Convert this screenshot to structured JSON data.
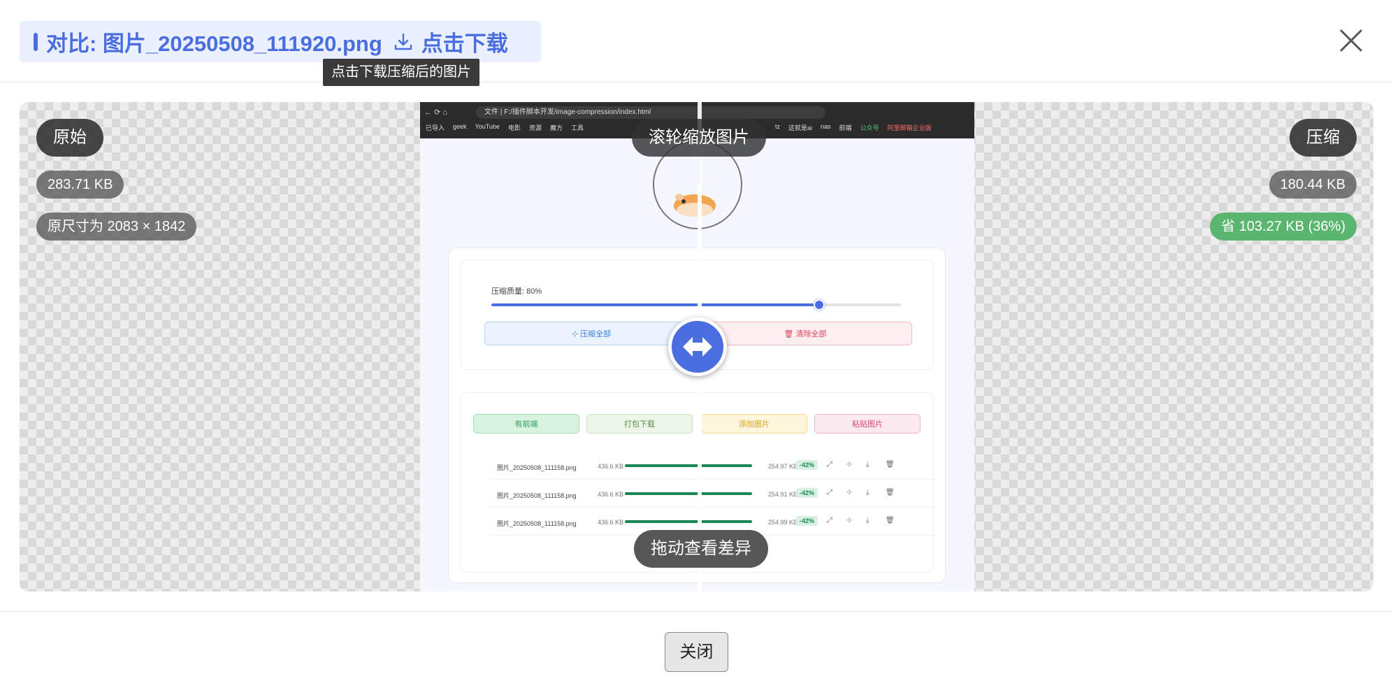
{
  "header": {
    "title": "对比: 图片_20250508_111920.png",
    "download_label": "点击下载",
    "tooltip": "点击下载压缩后的图片"
  },
  "original": {
    "label": "原始",
    "size": "283.71 KB",
    "dimensions": "原尺寸为 2083 × 1842"
  },
  "compressed": {
    "label": "压缩",
    "size": "180.44 KB",
    "savings": "省 103.27 KB (36%)"
  },
  "hints": {
    "zoom": "滚轮缩放图片",
    "drag": "拖动查看差异"
  },
  "screenshot": {
    "address": "文件 | F:/插件脚本开发/image-compression/index.html",
    "bookmarks": [
      "已导入",
      "geek",
      "YouTube",
      "电影",
      "资源",
      "魔方",
      "工具",
      "tz",
      "这就是ai",
      "nas",
      "前端",
      "公众号",
      "阿里邮箱企业版"
    ],
    "quality_label": "压缩质量: 80%",
    "quality_value": 0.8,
    "compress_all": "压缩全部",
    "clear_all": "清除全部",
    "action_buttons": [
      "有前端",
      "打包下载",
      "添加图片",
      "粘贴图片"
    ],
    "files": [
      {
        "name": "图片_20250508_111158.png",
        "original": "436.6 KB",
        "compressed": "254.97 KB",
        "pct": "-42%"
      },
      {
        "name": "图片_20250508_111158.png",
        "original": "436.6 KB",
        "compressed": "254.91 KB",
        "pct": "-42%"
      },
      {
        "name": "图片_20250508_111158.png",
        "original": "436.6 KB",
        "compressed": "254.99 KB",
        "pct": "-42%"
      }
    ]
  },
  "footer": {
    "close_label": "关闭"
  },
  "colors": {
    "accent": "#4a6ee0",
    "success": "#5ab56e",
    "title_bg": "#eaf0ff"
  }
}
